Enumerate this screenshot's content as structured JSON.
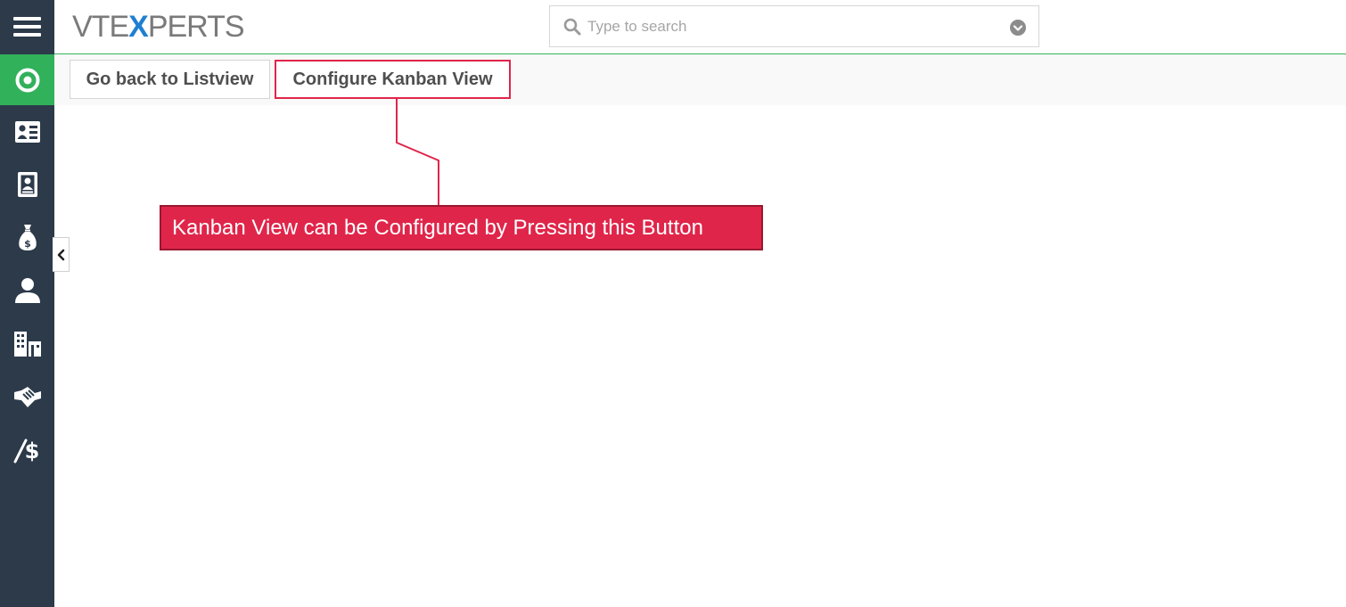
{
  "app": {
    "logo_text_prefix": "VTE",
    "logo_text_x": "X",
    "logo_text_suffix": "PERTS"
  },
  "search": {
    "placeholder": "Type to search"
  },
  "sidebar": {
    "items": [
      {
        "icon": "menu-icon"
      },
      {
        "icon": "target-icon",
        "active": true
      },
      {
        "icon": "contact-card-icon"
      },
      {
        "icon": "address-book-icon"
      },
      {
        "icon": "money-bag-icon"
      },
      {
        "icon": "user-icon"
      },
      {
        "icon": "buildings-icon"
      },
      {
        "icon": "handshake-icon"
      },
      {
        "icon": "pricing-icon"
      }
    ]
  },
  "toolbar": {
    "back_label": "Go back to Listview",
    "config_label": "Configure Kanban View"
  },
  "annotation": {
    "text": "Kanban View can be Configured by Pressing this Button"
  },
  "colors": {
    "sidebar_bg": "#2c3a4a",
    "active_green": "#31b15a",
    "highlight_red": "#e0254a",
    "logo_blue": "#1f7fd1"
  }
}
